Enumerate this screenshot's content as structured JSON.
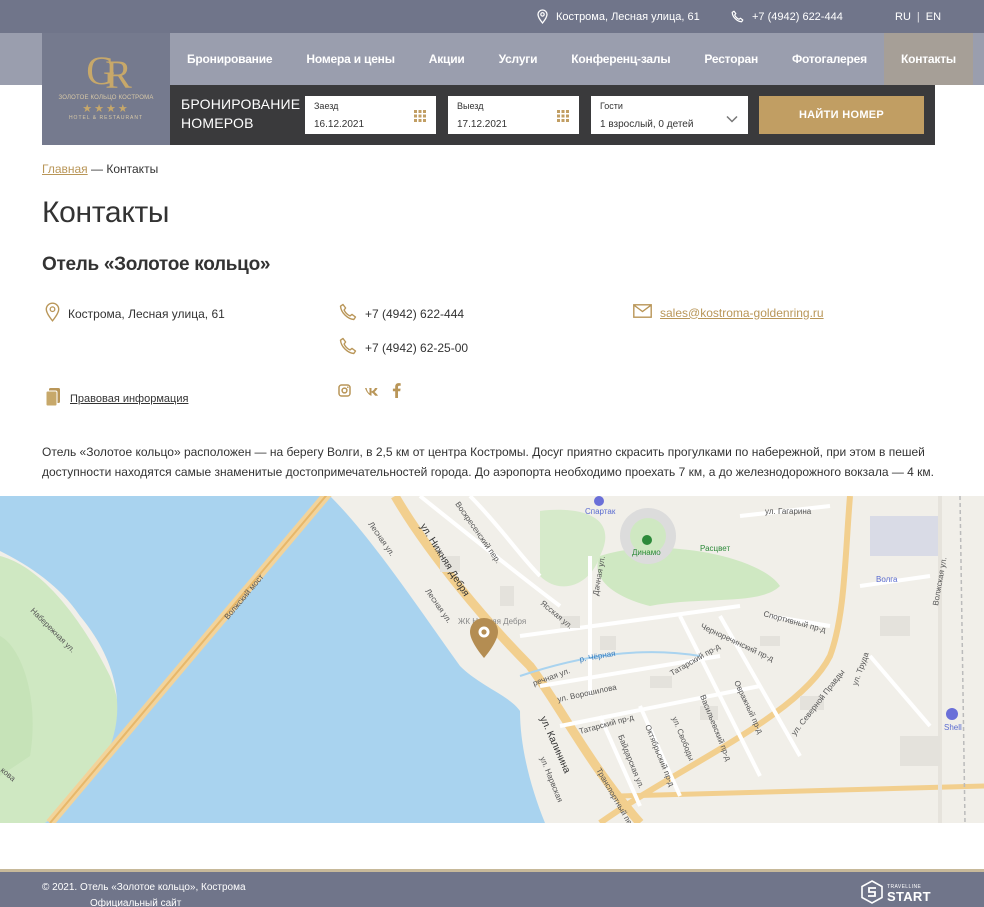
{
  "topbar": {
    "address": "Кострома, Лесная улица, 61",
    "phone": "+7 (4942) 622-444",
    "lang_ru": "RU",
    "lang_sep": "|",
    "lang_en": "EN"
  },
  "logo": {
    "mono_g": "G",
    "mono_r": "R",
    "line1": "ЗОЛОТОЕ КОЛЬЦО КОСТРОМА",
    "stars": "★★★★",
    "line2": "HOTEL & RESTAURANT"
  },
  "nav": {
    "items": [
      {
        "label": "Бронирование"
      },
      {
        "label": "Номера и цены"
      },
      {
        "label": "Акции"
      },
      {
        "label": "Услуги"
      },
      {
        "label": "Конференц-залы"
      },
      {
        "label": "Ресторан"
      },
      {
        "label": "Фотогалерея"
      },
      {
        "label": "Контакты"
      }
    ]
  },
  "booking": {
    "title_line1": "БРОНИРОВАНИЕ",
    "title_line2": "НОМЕРОВ",
    "checkin_label": "Заезд",
    "checkin_value": "16.12.2021",
    "checkout_label": "Выезд",
    "checkout_value": "17.12.2021",
    "guests_label": "Гости",
    "guests_value": "1 взрослый, 0 детей",
    "find_button": "НАЙТИ НОМЕР"
  },
  "breadcrumb": {
    "home": "Главная",
    "separator": " — ",
    "current": "Контакты"
  },
  "page_title": "Контакты",
  "hotel_title": "Отель «Золотое кольцо»",
  "contacts": {
    "address": "Кострома, Лесная улица, 61",
    "phone1": "+7 (4942) 622-444",
    "phone2": "+7 (4942) 62-25-00",
    "email": "sales@kostroma-goldenring.ru",
    "legal": "Правовая информация"
  },
  "description": "Отель «Золотое кольцо» расположен — на берегу Волги, в 2,5 км от центра Костромы. Досуг приятно скрасить прогулками по набережной, при этом в пешей доступности находятся самые знаменитые достопримечательностей города. До аэропорта необходимо проехать 7 км, а до железнодорожного вокзала — 4 км.",
  "map": {
    "labels": {
      "bridge": "Волжский мост",
      "naberezhnaya": "Набережная ул.",
      "lesnaya": "Лесная ул.",
      "lesnaya2": "Лесная ул.",
      "nizhnyaya": "ул. Нижняя Дебря",
      "voskresenskiy": "Воскресенский пер.",
      "spartak": "Спартак",
      "dinamo": "Динамо",
      "rasstvet": "Расцвет",
      "gagarina": "ул. Гагарина",
      "volga": "Волга",
      "volzhskaya": "Волжская ул.",
      "dachnaya": "Дачная ул.",
      "yasskaya": "Ясская ул.",
      "sportivny": "Спортивный пр-д",
      "chernorechensky": "Черноречинский пр-д",
      "river": "р. Чёрная",
      "rechnaya": "речная ул.",
      "voroshilova": "ул. Ворошилова",
      "tatarsky": "Татарский пр-д",
      "tatarsky2": "Татарский пр-д",
      "kalinina": "ул. Калинина",
      "baydarskaya": "Байдарская ул.",
      "oktyabrskiy": "Октябрьский пр-д",
      "svobody": "ул. Свободы",
      "vasilyevskiy": "Васильевский пр-д",
      "ovrazhny": "Овражный пр-д",
      "severnoy": "ул. Северной Правды",
      "truda": "ул. Труда",
      "shell": "Shell",
      "zhk": "ЖК Нижняя Дебря",
      "narvskaya": "ул. Нарвская",
      "transport": "Транспортный пер.",
      "kovo": "кова"
    }
  },
  "footer": {
    "copyright": "© 2021. Отель «Золотое кольцо», Кострома",
    "official": "Официальный сайт",
    "tl_small": "TRAVELLINE",
    "tl_big": "START"
  },
  "colors": {
    "topbar": "#70758a",
    "nav": "#9a9eae",
    "accent_gold": "#c19e63",
    "booking_bg": "#3a3a3c"
  }
}
